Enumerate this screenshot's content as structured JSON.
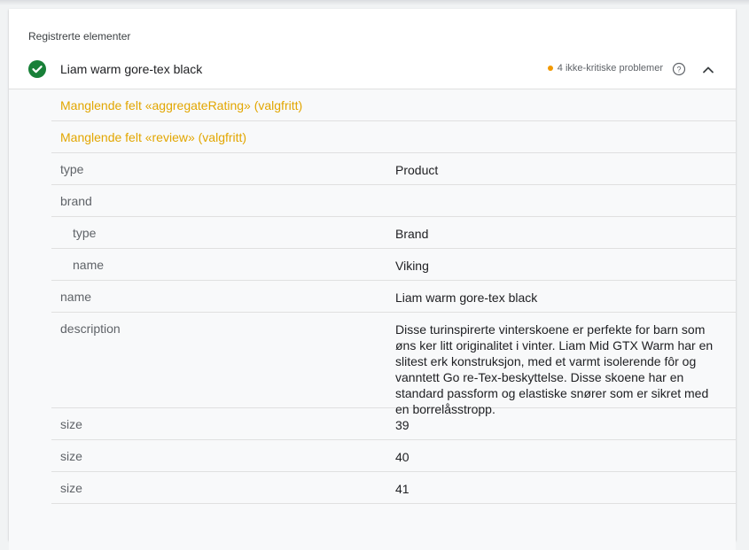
{
  "section": {
    "title": "Registrerte elementer"
  },
  "item": {
    "title": "Liam warm gore-tex black",
    "issues": "4 ikke-kritiske problemer",
    "status_color": "#188038",
    "warning_color": "#f29900"
  },
  "warnings": [
    "Manglende felt «aggregateRating» (valgfritt)",
    "Manglende felt «review» (valgfritt)"
  ],
  "properties": [
    {
      "key": "type",
      "value": "Product"
    },
    {
      "key": "brand",
      "value": ""
    },
    {
      "key": "type",
      "value": "Brand"
    },
    {
      "key": "name",
      "value": "Viking"
    },
    {
      "key": "name",
      "value": "Liam warm gore-tex black"
    },
    {
      "key": "description",
      "value": "Disse turinspirerte vinterskoene er perfekte for barn som øns ker litt originalitet i vinter. Liam Mid GTX Warm har en slitest erk konstruksjon, med et varmt isolerende fôr og vanntett Go re-Tex-beskyttelse. Disse skoene har en standard passform og elastiske snører som er sikret med en borrelåsstropp."
    },
    {
      "key": "size",
      "value": "39"
    },
    {
      "key": "size",
      "value": "40"
    },
    {
      "key": "size",
      "value": "41"
    }
  ]
}
